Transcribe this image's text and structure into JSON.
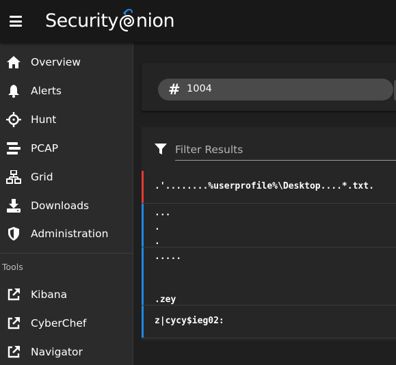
{
  "app": {
    "logo_text_left": "Security",
    "logo_text_right": "nion"
  },
  "colors": {
    "accent_blue": "#1e88e5",
    "alert_red": "#e53935",
    "sidebar_bg": "#2b2b2b",
    "topbar_bg": "#181818"
  },
  "sidebar": {
    "items": [
      {
        "label": "Overview",
        "icon": "home-icon"
      },
      {
        "label": "Alerts",
        "icon": "bell-icon"
      },
      {
        "label": "Hunt",
        "icon": "crosshairs-icon"
      },
      {
        "label": "PCAP",
        "icon": "stream-icon"
      },
      {
        "label": "Grid",
        "icon": "network-icon"
      },
      {
        "label": "Downloads",
        "icon": "download-icon"
      },
      {
        "label": "Administration",
        "icon": "shield-icon"
      }
    ],
    "tools_title": "Tools",
    "tools": [
      {
        "label": "Kibana",
        "icon": "external-link-icon"
      },
      {
        "label": "CyberChef",
        "icon": "external-link-icon"
      },
      {
        "label": "Navigator",
        "icon": "external-link-icon"
      }
    ]
  },
  "query": {
    "value": "1004"
  },
  "filter": {
    "placeholder": "Filter Results"
  },
  "results": [
    {
      "text": ".'........%userprofile%\\Desktop....*.txt.",
      "status": "red"
    },
    {
      "text": "...\n.\n.",
      "status": "blue"
    },
    {
      "text": ".....\n\n\n.zey",
      "status": "blue"
    },
    {
      "text": "z|cycy$ieg02:",
      "status": "blue"
    }
  ]
}
